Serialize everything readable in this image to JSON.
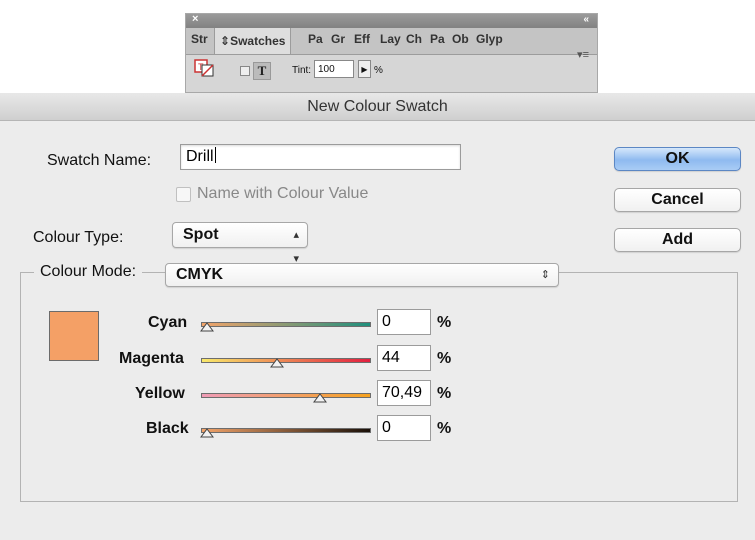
{
  "swatches_panel": {
    "tabs": [
      "Str",
      "Swatches",
      "Pa",
      "Gr",
      "Eff",
      "Lay",
      "Ch",
      "Pa",
      "Ob",
      "Glyp"
    ],
    "active_tab_icon": "updown-arrows-icon",
    "tint_label": "Tint:",
    "tint_value": "100",
    "tint_unit": "%"
  },
  "dialog": {
    "title": "New Colour Swatch",
    "swatch_name_label": "Swatch Name:",
    "swatch_name_value": "Drill",
    "name_with_colour_value_label": "Name with Colour Value",
    "colour_type_label": "Colour Type:",
    "colour_type_value": "Spot",
    "colour_mode_label": "Colour Mode:",
    "colour_mode_value": "CMYK",
    "buttons": {
      "ok": "OK",
      "cancel": "Cancel",
      "add": "Add"
    },
    "preview_color": "#f4a066",
    "sliders": [
      {
        "label": "Cyan",
        "value": "0",
        "unit": "%",
        "fraction": 0.0
      },
      {
        "label": "Magenta",
        "value": "44",
        "unit": "%",
        "fraction": 0.44
      },
      {
        "label": "Yellow",
        "value": "70,49",
        "unit": "%",
        "fraction": 0.7049
      },
      {
        "label": "Black",
        "value": "0",
        "unit": "%",
        "fraction": 0.0
      }
    ]
  },
  "colors": {
    "ok_button": "#8fbaf0",
    "cyan_track": [
      "#f3a46a",
      "#1f8f7d"
    ],
    "magenta_track": [
      "#f8e86a",
      "#e21f3f"
    ],
    "yellow_track": [
      "#ef9cb6",
      "#f6a21f"
    ],
    "black_track": [
      "#f3a46a",
      "#1a1008"
    ]
  }
}
